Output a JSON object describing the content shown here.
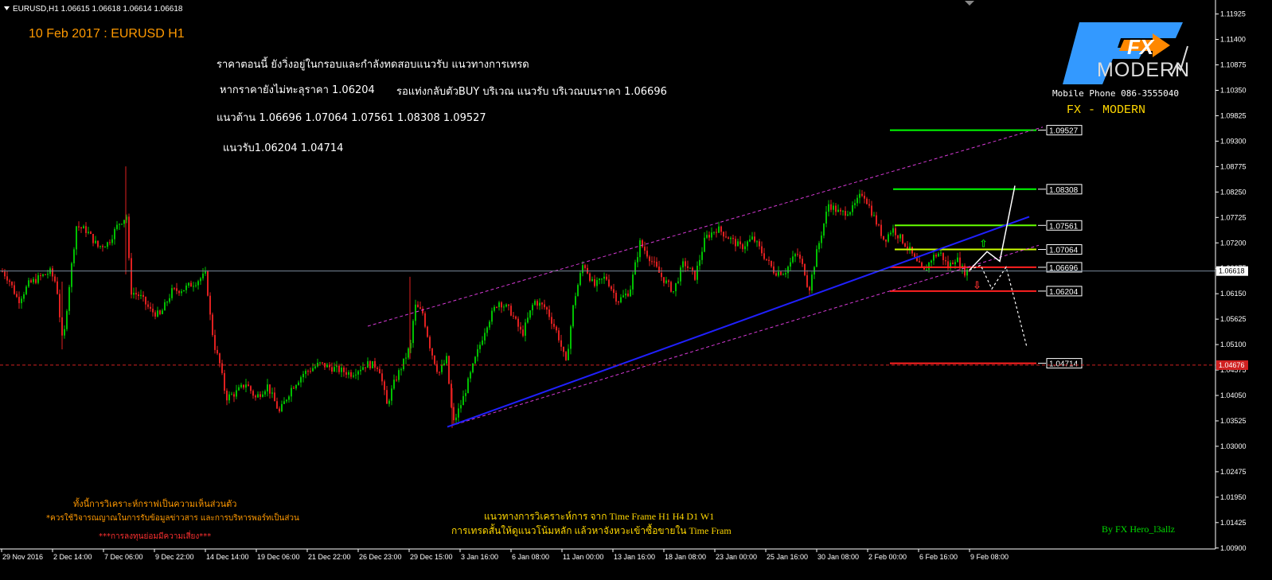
{
  "window": {
    "symbol_header": "EURUSD,H1  1.06615 1.06618 1.06614 1.06618",
    "menu_glyph": "▼"
  },
  "chart_data": {
    "type": "candlestick",
    "symbol": "EURUSD",
    "timeframe": "H1",
    "ohlc_header": {
      "open": 1.06615,
      "high": 1.06618,
      "low": 1.06614,
      "close": 1.06618
    },
    "ylim": [
      1.0088,
      1.1205
    ],
    "y_ticks": [
      "1.11925",
      "1.11400",
      "1.10875",
      "1.10350",
      "1.09825",
      "1.09300",
      "1.08775",
      "1.08250",
      "1.07725",
      "1.07200",
      "1.06675",
      "1.06150",
      "1.05625",
      "1.05100",
      "1.04575",
      "1.04050",
      "1.03525",
      "1.03000",
      "1.02475",
      "1.01950",
      "1.01425",
      "1.00900"
    ],
    "x_ticks": [
      "29 Nov 2016",
      "2 Dec 14:00",
      "7 Dec 06:00",
      "9 Dec 22:00",
      "14 Dec 14:00",
      "19 Dec 06:00",
      "21 Dec 22:00",
      "26 Dec 23:00",
      "29 Dec 15:00",
      "3 Jan 16:00",
      "6 Jan 08:00",
      "11 Jan 00:00",
      "13 Jan 16:00",
      "18 Jan 08:00",
      "23 Jan 00:00",
      "25 Jan 16:00",
      "30 Jan 08:00",
      "2 Feb 00:00",
      "6 Feb 16:00",
      "9 Feb 08:00"
    ],
    "current_price": {
      "label": "1.06618",
      "value": 1.06618
    },
    "red_dashed_level": {
      "label": "1.04676",
      "value": 1.04676
    },
    "price_path": [
      [
        0,
        1.0665
      ],
      [
        10,
        1.0645
      ],
      [
        22,
        1.06
      ],
      [
        35,
        1.0635
      ],
      [
        50,
        1.065
      ],
      [
        62,
        1.066
      ],
      [
        70,
        1.0635
      ],
      [
        78,
        1.0505
      ],
      [
        85,
        1.062
      ],
      [
        95,
        1.0755
      ],
      [
        108,
        1.0745
      ],
      [
        122,
        1.0712
      ],
      [
        135,
        1.072
      ],
      [
        148,
        1.076
      ],
      [
        158,
        1.0775
      ],
      [
        163,
        1.062
      ],
      [
        175,
        1.061
      ],
      [
        188,
        1.058
      ],
      [
        200,
        1.057
      ],
      [
        215,
        1.062
      ],
      [
        230,
        1.0625
      ],
      [
        245,
        1.064
      ],
      [
        258,
        1.0655
      ],
      [
        262,
        1.058
      ],
      [
        268,
        1.051
      ],
      [
        275,
        1.047
      ],
      [
        283,
        1.04
      ],
      [
        295,
        1.041
      ],
      [
        308,
        1.043
      ],
      [
        320,
        1.04
      ],
      [
        335,
        1.0425
      ],
      [
        350,
        1.037
      ],
      [
        365,
        1.042
      ],
      [
        380,
        1.045
      ],
      [
        400,
        1.047
      ],
      [
        420,
        1.046
      ],
      [
        440,
        1.045
      ],
      [
        460,
        1.047
      ],
      [
        475,
        1.0465
      ],
      [
        485,
        1.0385
      ],
      [
        495,
        1.0435
      ],
      [
        505,
        1.047
      ],
      [
        515,
        1.051
      ],
      [
        520,
        1.059
      ],
      [
        530,
        1.0575
      ],
      [
        540,
        1.05
      ],
      [
        550,
        1.045
      ],
      [
        560,
        1.048
      ],
      [
        568,
        1.0345
      ],
      [
        580,
        1.0395
      ],
      [
        595,
        1.0475
      ],
      [
        610,
        1.055
      ],
      [
        625,
        1.06
      ],
      [
        640,
        1.058
      ],
      [
        655,
        1.053
      ],
      [
        670,
        1.06
      ],
      [
        685,
        1.0585
      ],
      [
        700,
        1.053
      ],
      [
        710,
        1.047
      ],
      [
        720,
        1.06
      ],
      [
        732,
        1.068
      ],
      [
        745,
        1.063
      ],
      [
        760,
        1.065
      ],
      [
        775,
        1.06
      ],
      [
        790,
        1.062
      ],
      [
        803,
        1.072
      ],
      [
        815,
        1.069
      ],
      [
        830,
        1.065
      ],
      [
        845,
        1.062
      ],
      [
        858,
        1.068
      ],
      [
        872,
        1.065
      ],
      [
        885,
        1.073
      ],
      [
        900,
        1.075
      ],
      [
        915,
        1.073
      ],
      [
        930,
        1.071
      ],
      [
        945,
        1.073
      ],
      [
        960,
        1.069
      ],
      [
        972,
        1.066
      ],
      [
        985,
        1.066
      ],
      [
        1000,
        1.07
      ],
      [
        1010,
        1.066
      ],
      [
        1015,
        1.062
      ],
      [
        1025,
        1.07
      ],
      [
        1040,
        1.08
      ],
      [
        1055,
        1.078
      ],
      [
        1070,
        1.079
      ],
      [
        1083,
        1.0825
      ],
      [
        1095,
        1.078
      ],
      [
        1110,
        1.0725
      ],
      [
        1120,
        1.075
      ],
      [
        1130,
        1.073
      ],
      [
        1140,
        1.071
      ],
      [
        1150,
        1.068
      ],
      [
        1160,
        1.066
      ],
      [
        1170,
        1.069
      ],
      [
        1180,
        1.07
      ],
      [
        1190,
        1.067
      ],
      [
        1200,
        1.069
      ],
      [
        1210,
        1.066
      ],
      [
        1218,
        1.0664
      ]
    ],
    "channel_upper": {
      "from": [
        462,
        1.0548
      ],
      "to": [
        1310,
        1.0959
      ]
    },
    "channel_lower": {
      "from": [
        566,
        1.0342
      ],
      "to": [
        1305,
        1.0715
      ]
    },
    "trend_line": {
      "from": [
        562,
        1.034
      ],
      "to": [
        1293,
        1.0774
      ]
    },
    "projection_bull": [
      [
        1218,
        1.0664
      ],
      [
        1240,
        1.0702
      ],
      [
        1256,
        1.0682
      ],
      [
        1275,
        1.0838
      ]
    ],
    "projection_bear": [
      [
        1218,
        1.0664
      ],
      [
        1232,
        1.0674
      ],
      [
        1246,
        1.0625
      ],
      [
        1264,
        1.067
      ],
      [
        1290,
        1.0505
      ]
    ],
    "horizontal_levels": [
      {
        "label": "1.09527",
        "value": 1.09527,
        "color": "#00ff00",
        "x_start": 1118
      },
      {
        "label": "1.08308",
        "value": 1.08308,
        "color": "#00ff00",
        "x_start": 1122
      },
      {
        "label": "1.07561",
        "value": 1.07561,
        "color": "#66ff00",
        "x_start": 1124
      },
      {
        "label": "1.07064",
        "value": 1.07064,
        "color": "#ccff00",
        "x_start": 1124
      },
      {
        "label": "1.06696",
        "value": 1.06696,
        "color": "#ff2020",
        "x_start": 1118
      },
      {
        "label": "1.06204",
        "value": 1.06204,
        "color": "#ff2020",
        "x_start": 1118
      },
      {
        "label": "1.04714",
        "value": 1.04714,
        "color": "#ff2020",
        "x_start": 1118
      }
    ]
  },
  "overlay": {
    "chart_title": "10 Feb 2017 : EURUSD H1",
    "analysis_line1": "ราคาตอนนี้ ยังวิ่งอยู่ในกรอบและกำลังทดสอบแนวรับ    แนวทางการเทรด",
    "analysis_line2a": "หากราคายังไม่ทะลุราคา 1.06204",
    "analysis_line2b": "รอแท่งกลับตัวBUY บริเวณ แนวรับ บริเวณบนราคา 1.06696",
    "resistance_line": "แนวต้าน 1.06696  1.07064  1.07561  1.08308  1.09527",
    "support_line": "แนวรับ1.06204  1.04714",
    "logo_fx": "FX",
    "logo_modern": "MODERN",
    "mobile_phone": "Mobile Phone 086-3555040",
    "brand_text": "FX  -  MODERN",
    "disclaimer1": "ทั้งนี้การวิเคราะห์กราฟเป็นความเห็นส่วนตัว",
    "disclaimer2": "*ควรใช้วิจารณญาณในการรับข้อมูลข่าวสาร และการบริหารพอร์ทเป็นส่วน",
    "disclaimer3": "***การลงทุนย่อมมีความเสี่ยง***",
    "method_line1": "แนวทางการวิเคราะห์การ จาก Time Frame H1 H4 D1 W1",
    "method_line2": "การเทรดสั้นให้ดูแนวโน้มหลัก แล้วหาจังหวะเข้าซื้อขายใน Time Fram",
    "author": "By FX Hero_l3allz"
  },
  "colors": {
    "background": "#000000",
    "bull_candle": "#00c000",
    "bear_candle": "#e02020",
    "channel": "#d63ad6",
    "trend": "#2020ff",
    "title": "#ff9900",
    "gold": "#ffd700",
    "logo_blue": "#3399ff",
    "logo_orange": "#ff8800"
  }
}
